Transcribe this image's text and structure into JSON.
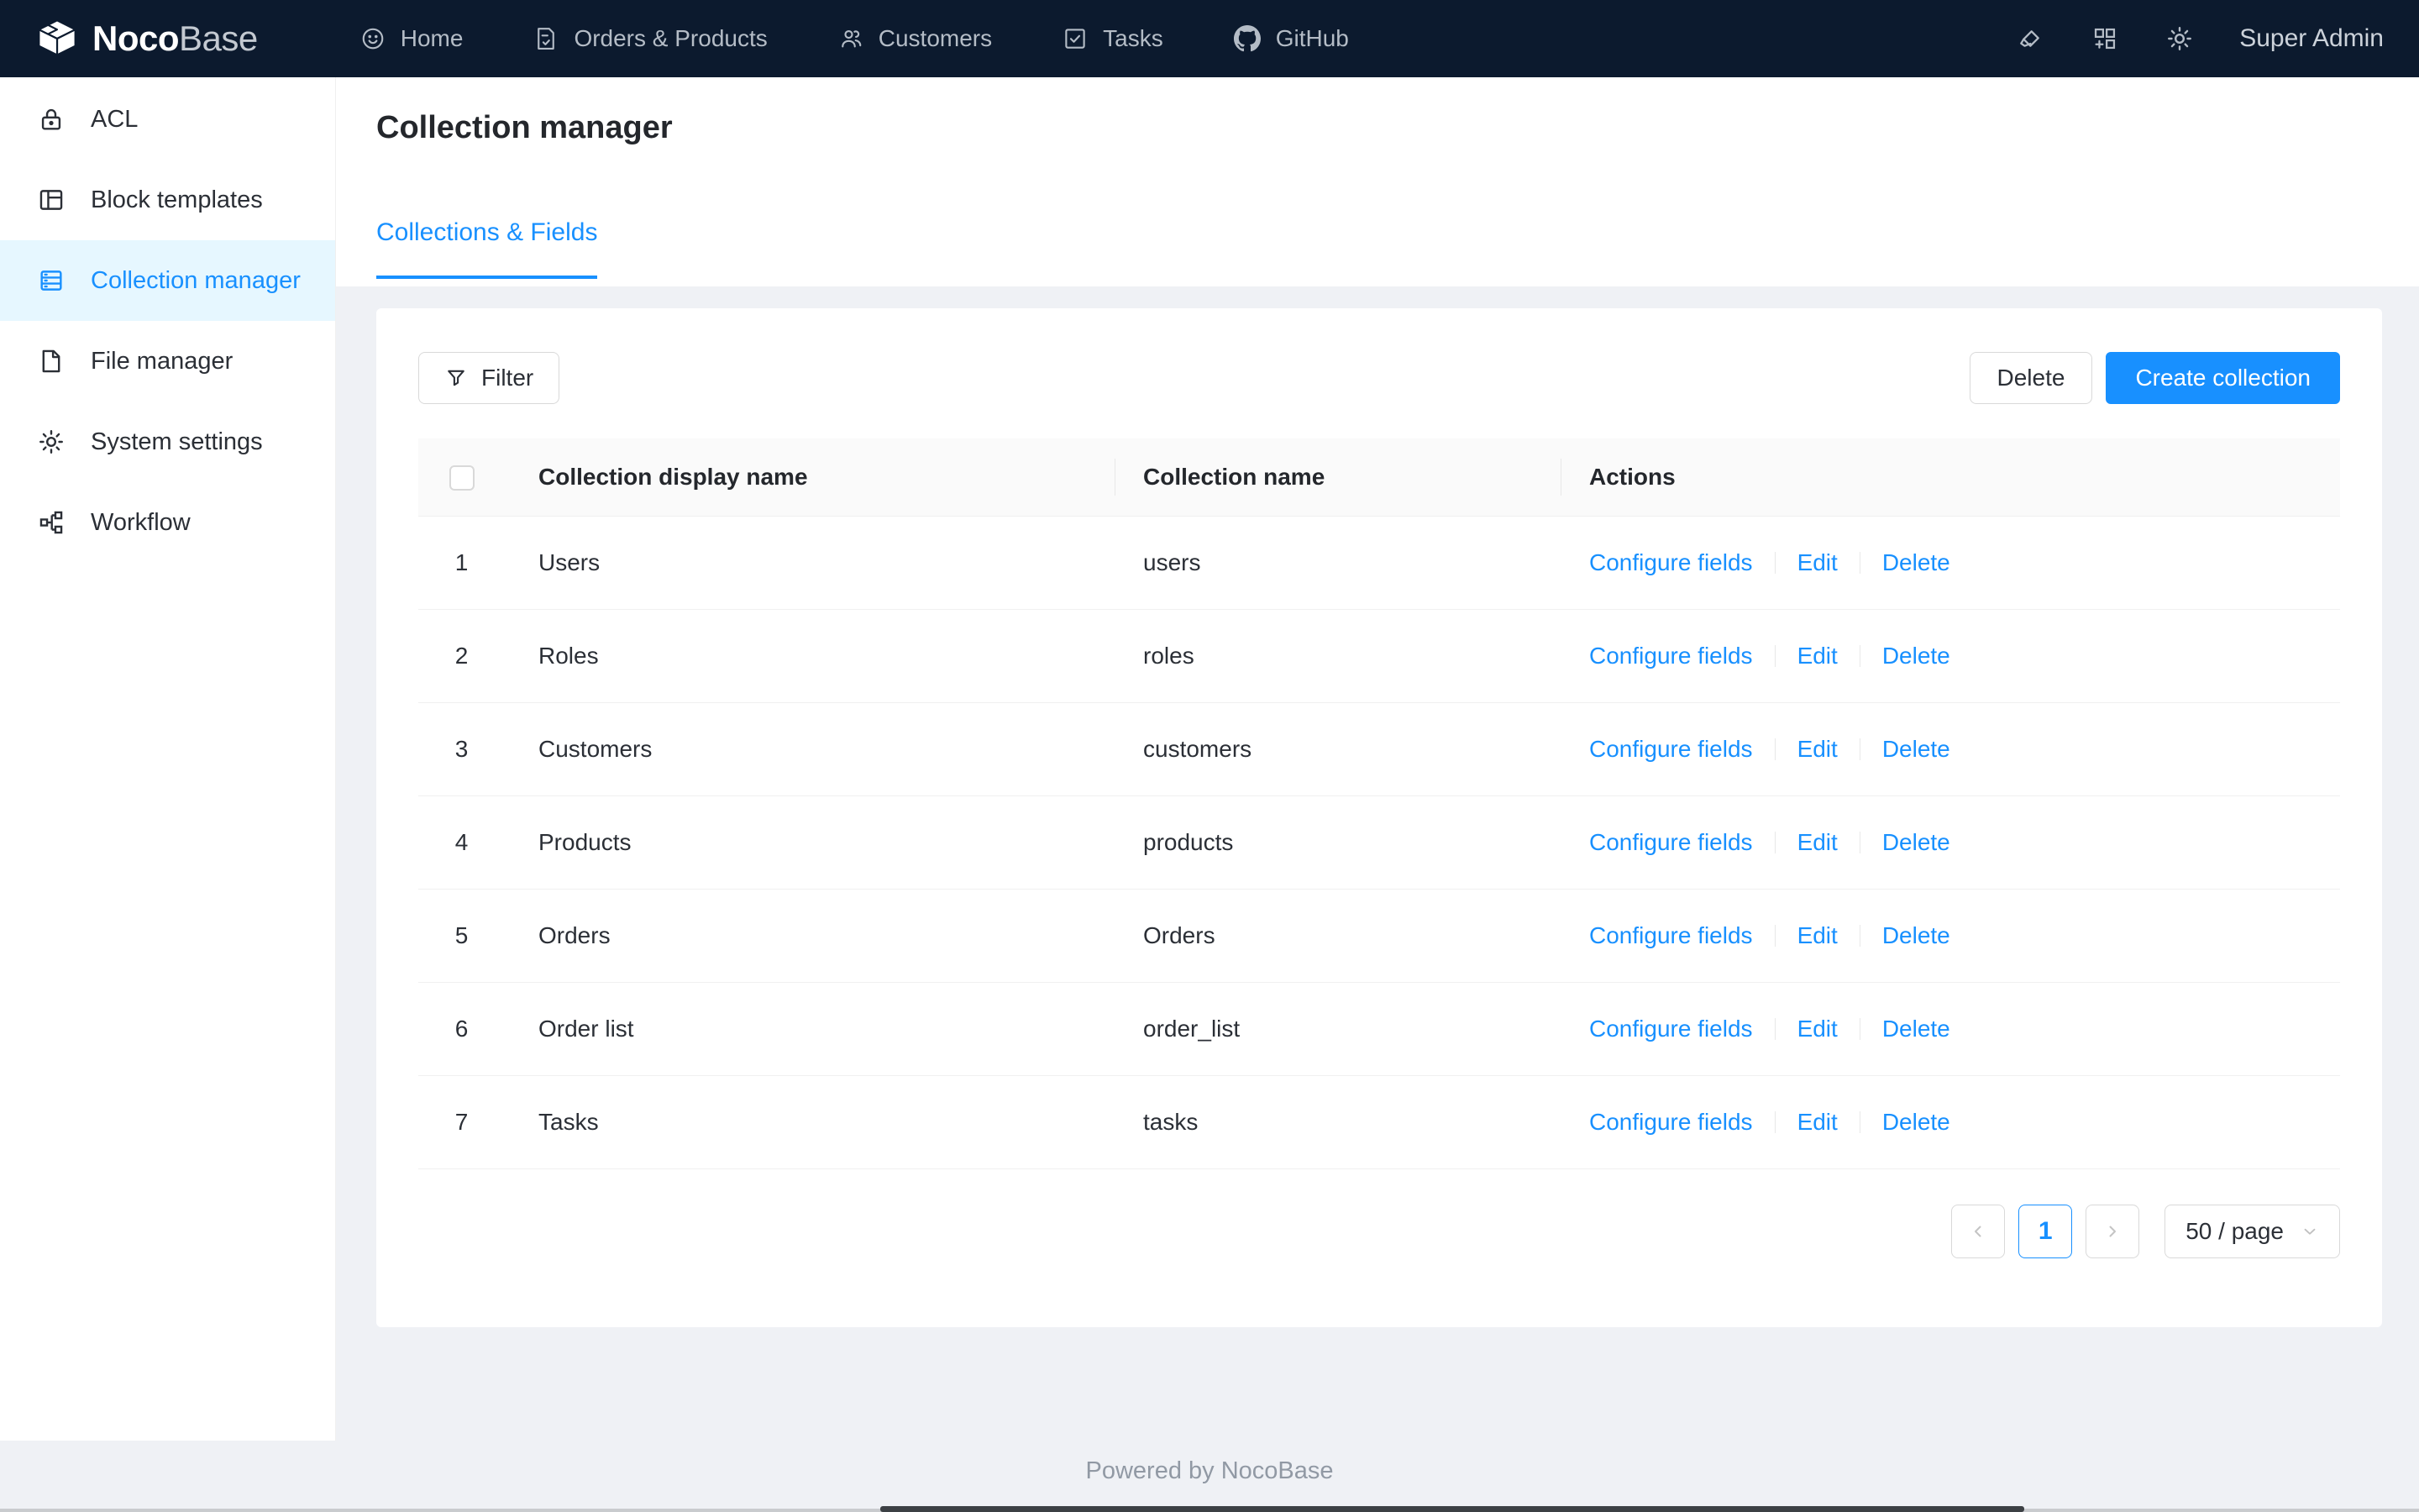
{
  "topbar": {
    "logo": {
      "brand_bold": "Noco",
      "brand_light": "Base"
    },
    "nav": [
      {
        "label": "Home",
        "icon": "smile-icon"
      },
      {
        "label": "Orders & Products",
        "icon": "file-done-icon"
      },
      {
        "label": "Customers",
        "icon": "team-icon"
      },
      {
        "label": "Tasks",
        "icon": "check-square-icon"
      },
      {
        "label": "GitHub",
        "icon": "github-icon"
      }
    ],
    "right_icons": [
      "highlighter-icon",
      "appstore-add-icon",
      "gear-icon"
    ],
    "user": "Super Admin"
  },
  "sidebar": {
    "items": [
      {
        "label": "ACL",
        "icon": "lock-icon",
        "selected": false
      },
      {
        "label": "Block templates",
        "icon": "layout-icon",
        "selected": false
      },
      {
        "label": "Collection manager",
        "icon": "collection-icon",
        "selected": true
      },
      {
        "label": "File manager",
        "icon": "file-icon",
        "selected": false
      },
      {
        "label": "System settings",
        "icon": "gear-icon",
        "selected": false
      },
      {
        "label": "Workflow",
        "icon": "workflow-icon",
        "selected": false
      }
    ]
  },
  "page": {
    "title": "Collection manager",
    "tab": "Collections & Fields"
  },
  "toolbar": {
    "filter_label": "Filter",
    "delete_label": "Delete",
    "create_label": "Create collection"
  },
  "table": {
    "headers": [
      "Collection display name",
      "Collection name",
      "Actions"
    ],
    "rows": [
      {
        "index": "1",
        "display_name": "Users",
        "name": "users"
      },
      {
        "index": "2",
        "display_name": "Roles",
        "name": "roles"
      },
      {
        "index": "3",
        "display_name": "Customers",
        "name": "customers"
      },
      {
        "index": "4",
        "display_name": "Products",
        "name": "products"
      },
      {
        "index": "5",
        "display_name": "Orders",
        "name": "Orders"
      },
      {
        "index": "6",
        "display_name": "Order list",
        "name": "order_list"
      },
      {
        "index": "7",
        "display_name": "Tasks",
        "name": "tasks"
      }
    ],
    "row_actions": [
      "Configure fields",
      "Edit",
      "Delete"
    ]
  },
  "pagination": {
    "current": "1",
    "page_size": "50 / page"
  },
  "footer": {
    "text": "Powered by NocoBase"
  },
  "colors": {
    "accent": "#1890ff",
    "topbar_bg": "#0c1a2e",
    "selected_item_bg": "#e6f7ff",
    "page_bg": "#eff1f5",
    "border": "#d9d9d9",
    "row_border": "#f0f0f0"
  }
}
